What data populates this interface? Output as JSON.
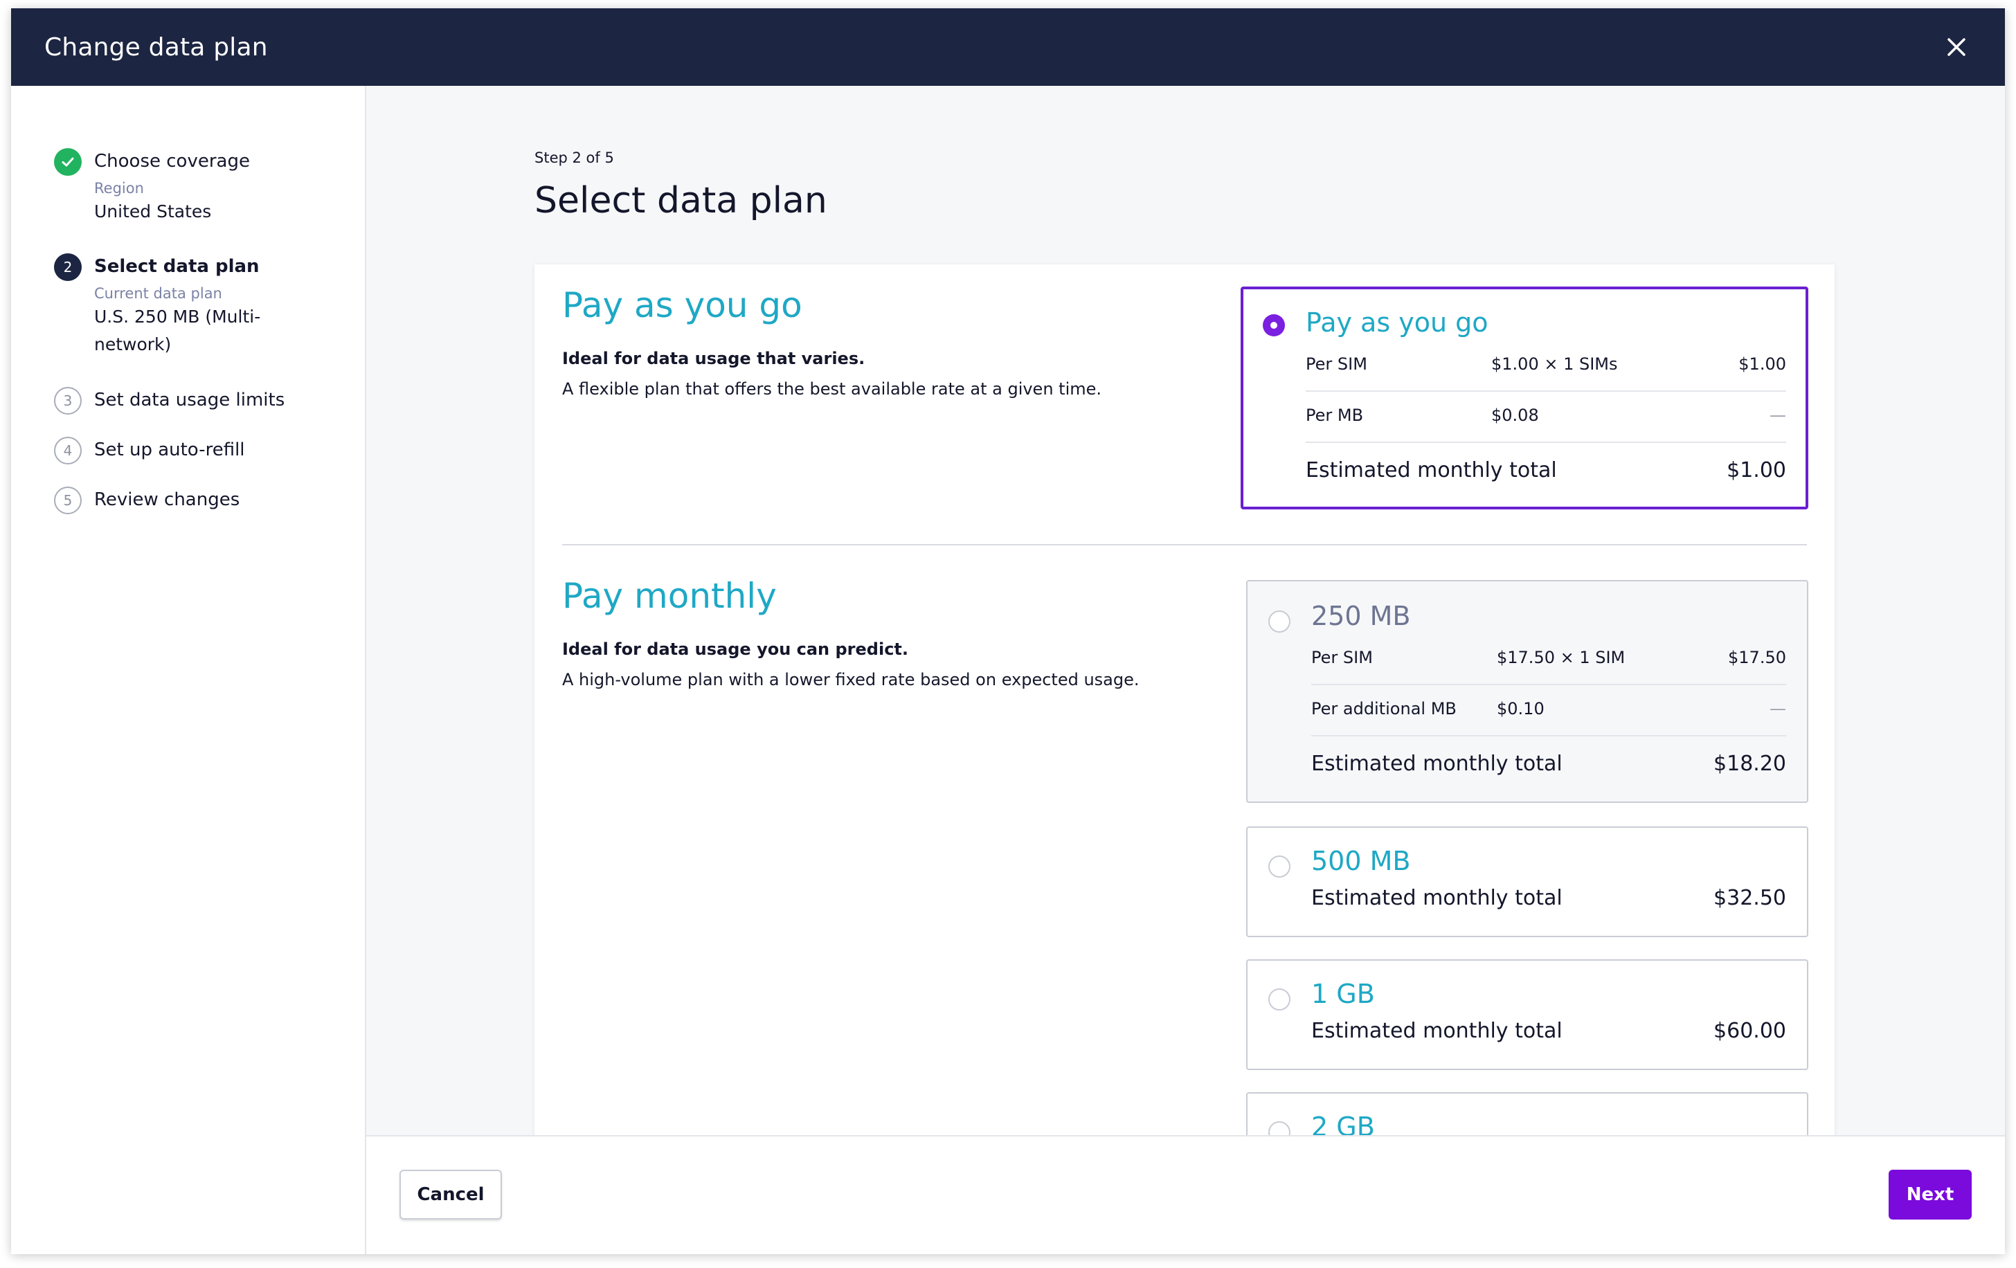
{
  "header": {
    "title": "Change data plan",
    "close_icon": "close-icon"
  },
  "sidebar": {
    "steps": [
      {
        "number": "",
        "status": "done",
        "title": "Choose coverage",
        "sub_label": "Region",
        "sub_value": "United States"
      },
      {
        "number": "2",
        "status": "active",
        "title": "Select data plan",
        "sub_label": "Current data plan",
        "sub_value": "U.S. 250 MB (Multi-network)"
      },
      {
        "number": "3",
        "status": "pending",
        "title": "Set data usage limits"
      },
      {
        "number": "4",
        "status": "pending",
        "title": "Set up auto-refill"
      },
      {
        "number": "5",
        "status": "pending",
        "title": "Review changes"
      }
    ]
  },
  "main": {
    "step_indicator": "Step 2 of 5",
    "title": "Select data plan",
    "payg": {
      "heading": "Pay as you go",
      "tagline": "Ideal for data usage that varies.",
      "description": "A flexible plan that offers the best available rate at a given time.",
      "option": {
        "name": "Pay as you go",
        "selected": true,
        "rows": [
          {
            "label": "Per SIM",
            "rate": "$1.00 × 1 SIMs",
            "amount": "$1.00"
          },
          {
            "label": "Per MB",
            "rate": "$0.08",
            "amount": "—"
          }
        ],
        "total_label": "Estimated monthly total",
        "total": "$1.00"
      }
    },
    "monthly": {
      "heading": "Pay monthly",
      "tagline": "Ideal for data usage you can predict.",
      "description": "A high-volume plan with a lower fixed rate based on expected usage.",
      "options": [
        {
          "name": "250 MB",
          "disabled": true,
          "rows": [
            {
              "label": "Per SIM",
              "rate": "$17.50 × 1 SIM",
              "amount": "$17.50"
            },
            {
              "label": "Per additional MB",
              "rate": "$0.10",
              "amount": "—"
            }
          ],
          "total_label": "Estimated monthly total",
          "total": "$18.20"
        },
        {
          "name": "500 MB",
          "total_label": "Estimated monthly total",
          "total": "$32.50"
        },
        {
          "name": "1 GB",
          "total_label": "Estimated monthly total",
          "total": "$60.00"
        },
        {
          "name": "2 GB"
        }
      ]
    }
  },
  "footer": {
    "cancel_label": "Cancel",
    "next_label": "Next"
  },
  "colors": {
    "header_bg": "#1c2541",
    "accent_purple": "#7a0bdc",
    "plan_name": "#1ea8c5",
    "done_green": "#21b35f"
  }
}
